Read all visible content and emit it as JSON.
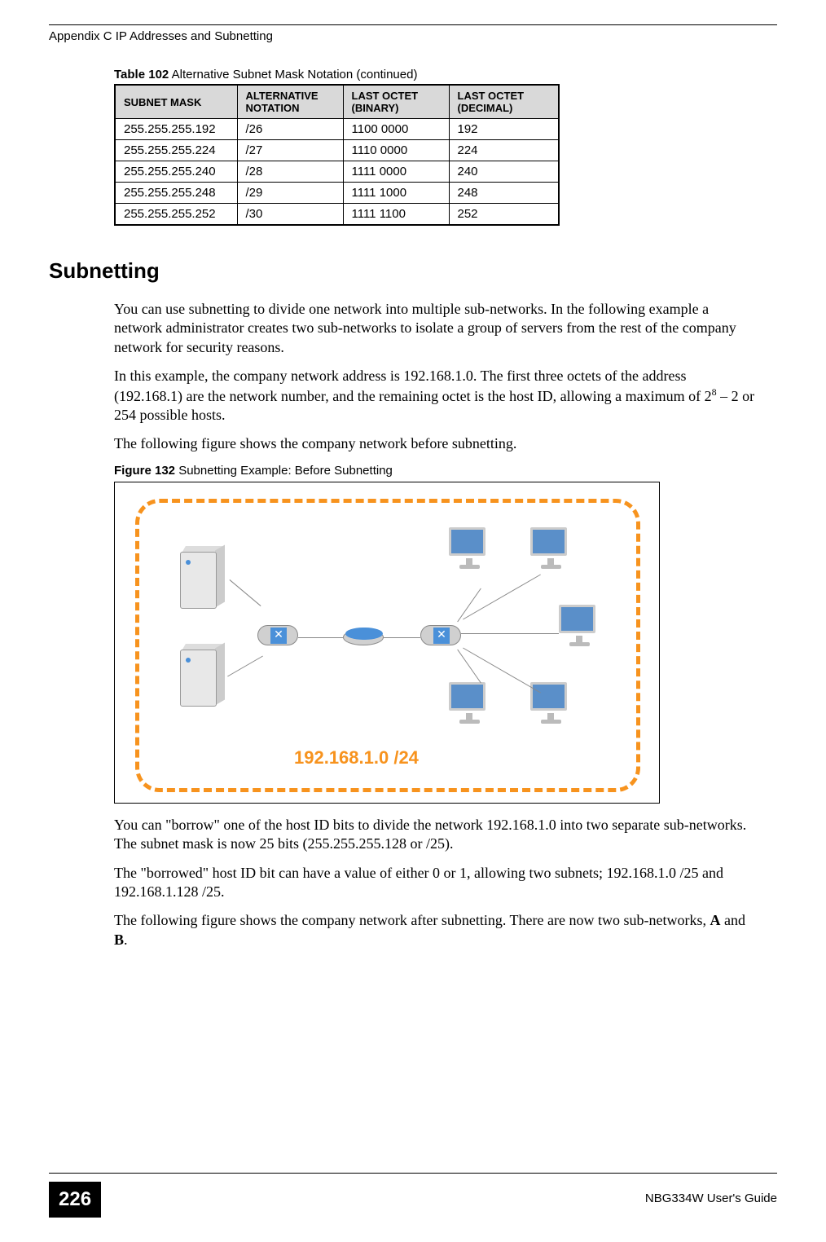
{
  "header": "Appendix C IP Addresses and Subnetting",
  "table": {
    "caption_bold": "Table 102",
    "caption_rest": "   Alternative Subnet Mask Notation (continued)",
    "headers": [
      "SUBNET MASK",
      "ALTERNATIVE NOTATION",
      "LAST OCTET (BINARY)",
      "LAST OCTET (DECIMAL)"
    ],
    "rows": [
      [
        "255.255.255.192",
        "/26",
        "1100 0000",
        "192"
      ],
      [
        "255.255.255.224",
        "/27",
        "1110 0000",
        "224"
      ],
      [
        "255.255.255.240",
        "/28",
        "1111 0000",
        "240"
      ],
      [
        "255.255.255.248",
        "/29",
        "1111 1000",
        "248"
      ],
      [
        "255.255.255.252",
        "/30",
        "1111 1100",
        "252"
      ]
    ]
  },
  "heading": "Subnetting",
  "para1": "You can use subnetting to divide one network into multiple sub-networks. In the following example a network administrator creates two sub-networks to isolate a group of servers from the rest of the company network for security reasons.",
  "para2a": "In this example, the company network address is 192.168.1.0. The first three octets of the address (192.168.1) are the network number, and the remaining octet is the host ID, allowing a maximum of 2",
  "para2sup": "8",
  "para2b": " – 2 or 254 possible hosts.",
  "para3": "The following figure shows the company network before subnetting.",
  "figure": {
    "caption_bold": "Figure 132",
    "caption_rest": "   Subnetting Example: Before Subnetting",
    "network_label": "192.168.1.0 /24"
  },
  "para4": "You can \"borrow\" one of the host ID bits to divide the network 192.168.1.0 into two separate sub-networks. The subnet mask is now 25 bits (255.255.255.128 or /25).",
  "para5": "The \"borrowed\" host ID bit can have a value of either 0 or 1, allowing two subnets; 192.168.1.0 /25 and 192.168.1.128 /25.",
  "para6a": "The following figure shows the company network after subnetting. There are now two sub-networks, ",
  "para6b": "A",
  "para6c": " and ",
  "para6d": "B",
  "para6e": ".",
  "footer": {
    "page": "226",
    "guide": "NBG334W User's Guide"
  }
}
